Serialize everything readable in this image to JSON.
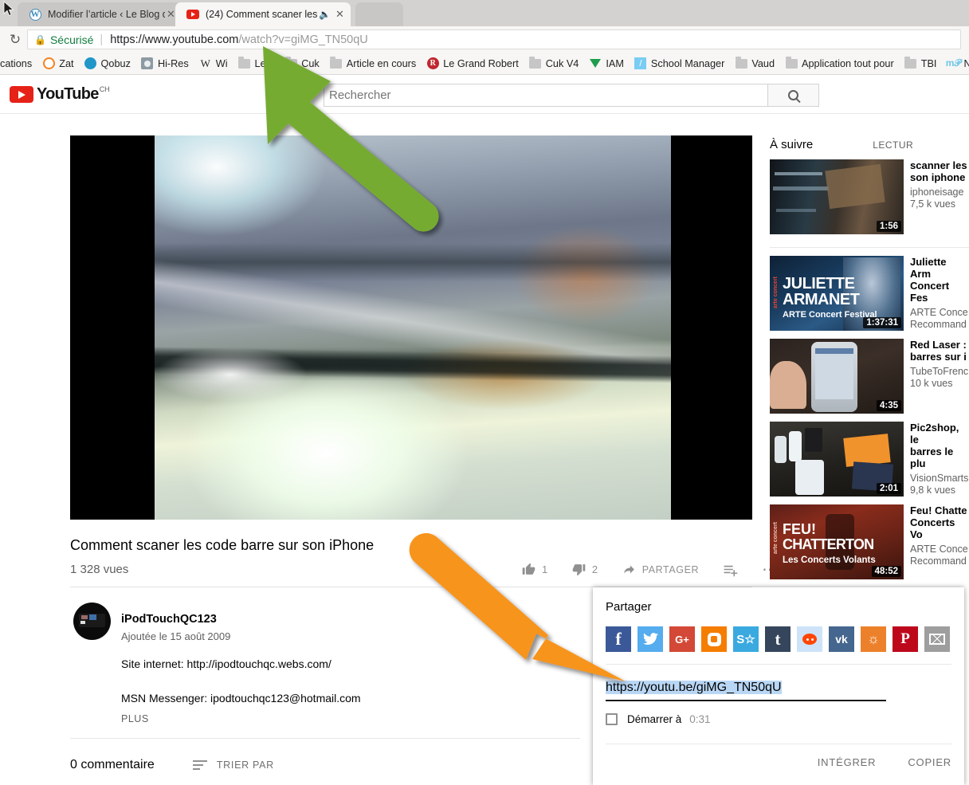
{
  "browser": {
    "tabs": [
      {
        "favicon": "wordpress-icon",
        "title": "Modifier l’article ‹ Le Blog du ",
        "title_fade": "C",
        "active": false,
        "muted": false
      },
      {
        "favicon": "youtube-icon",
        "title": "(24) Comment scaner les ",
        "title_fade": "co",
        "active": true,
        "muted": true
      }
    ],
    "reload_icon": "reload-icon",
    "omnibox": {
      "lock_icon": "lock-icon",
      "secure_label": "Sécurisé",
      "url_prefix": "https://www.youtube.com",
      "url_suffix": "/watch?v=giMG_TN50qU"
    },
    "bookmarks": [
      {
        "label": "cations",
        "icon": "none"
      },
      {
        "label": "Zat",
        "icon": "zat-icon",
        "color": "#F5821F"
      },
      {
        "label": "Qobuz",
        "icon": "qobuz-icon",
        "color": "#2196C9"
      },
      {
        "label": "Hi-Res",
        "icon": "hires-icon",
        "color": "#6E7C86"
      },
      {
        "label": "Wi",
        "icon": "wikipedia-icon",
        "color": "#222222"
      },
      {
        "label": "Le b",
        "icon": "folder-icon"
      },
      {
        "label": "Cuk",
        "icon": "folder-icon"
      },
      {
        "label": "Article en cours",
        "icon": "folder-icon"
      },
      {
        "label": "Le Grand Robert",
        "icon": "robert-icon",
        "color": "#C0272D"
      },
      {
        "label": "Cuk V4",
        "icon": "folder-icon"
      },
      {
        "label": "IAM",
        "icon": "iam-icon",
        "color": "#1F9D4B"
      },
      {
        "label": "School Manager",
        "icon": "school-icon",
        "color": "#79CDF2"
      },
      {
        "label": "Vaud",
        "icon": "folder-icon"
      },
      {
        "label": "Application tout pour",
        "icon": "folder-icon"
      },
      {
        "label": "TBI",
        "icon": "folder-icon"
      },
      {
        "label": "N",
        "icon": "mu-icon",
        "color": "#6FC6E8"
      }
    ]
  },
  "youtube": {
    "logo_word": "YouTube",
    "logo_country": "CH",
    "search": {
      "placeholder": "Rechercher",
      "button_icon": "search-icon"
    },
    "video": {
      "title": "Comment scaner les code barre sur son iPhone",
      "views": "1 328 vues",
      "likes": "1",
      "dislikes": "2",
      "share_label": "PARTAGER",
      "save_icon": "add-to-playlist-icon",
      "more_icon": "more-options-icon"
    },
    "uploader": {
      "name": "iPodTouchQC123",
      "date": "Ajoutée le 15 août 2009",
      "desc_line1": "Site internet: http://ipodtouchqc.webs.com/",
      "desc_line2": "MSN Messenger: ipodtouchqc123@hotmail.com",
      "more_label": "PLUS"
    },
    "comments": {
      "count_label": "0 commentaire",
      "sort_label": "TRIER PAR",
      "sort_icon": "sort-icon"
    },
    "sidebar": {
      "title": "À suivre",
      "autoplay_label": "LECTUR",
      "items": [
        {
          "title": "scanner les\nson iphone",
          "channel": "iphoneisage",
          "views": "7,5 k vues",
          "duration": "1:56",
          "thumb": "dark-shelf"
        },
        {
          "title": "Juliette Arm\nConcert Fes",
          "channel": "ARTE Conce",
          "views": "Recommand",
          "duration": "1:37:31",
          "thumb": "juliette-armanet",
          "thumb_text1": "JULIETTE",
          "thumb_text2": "ARMANET",
          "thumb_text3": "ARTE Concert Festival",
          "thumb_badge": "arte concert"
        },
        {
          "title": "Red Laser :\nbarres sur i",
          "channel": "TubeToFrenc",
          "views": "10 k vues",
          "duration": "4:35",
          "thumb": "iphone-hand"
        },
        {
          "title": "Pic2shop, le\nbarres le plu",
          "channel": "VisionSmarts",
          "views": "9,8 k vues",
          "duration": "2:01",
          "thumb": "desk-products"
        },
        {
          "title": "Feu! Chatte\nConcerts Vo",
          "channel": "ARTE Conce",
          "views": "Recommand",
          "duration": "48:52",
          "thumb": "feu-chatterton",
          "thumb_text1": "FEU!",
          "thumb_text2": "CHATTERTON",
          "thumb_text3": "Les Concerts Volants",
          "thumb_badge": "arte concert"
        }
      ]
    },
    "share_panel": {
      "title": "Partager",
      "social": [
        {
          "name": "facebook",
          "glyph": "f",
          "color": "#3b5998"
        },
        {
          "name": "twitter",
          "glyph": "🐦",
          "color": "#55acee"
        },
        {
          "name": "google-plus",
          "glyph": "G+",
          "color": "#d34836"
        },
        {
          "name": "blogger",
          "glyph": "B",
          "color": "#f57d00"
        },
        {
          "name": "stumbleupon",
          "glyph": "S☆",
          "color": "#3aa9e0"
        },
        {
          "name": "tumblr",
          "glyph": "t",
          "color": "#35465c"
        },
        {
          "name": "reddit",
          "glyph": "●",
          "color": "#cee3f8"
        },
        {
          "name": "vk",
          "glyph": "vk",
          "color": "#45668e"
        },
        {
          "name": "odnoklassniki",
          "glyph": "⚘",
          "color": "#ed812b"
        },
        {
          "name": "pinterest",
          "glyph": "P",
          "color": "#bd081c"
        },
        {
          "name": "email",
          "glyph": "✉",
          "color": "#9e9e9e"
        }
      ],
      "url": "https://youtu.be/giMG_TN50qU",
      "start_at_label": "Démarrer à",
      "start_at_time": "0:31",
      "embed_label": "INTÉGRER",
      "copy_label": "COPIER"
    }
  },
  "annotations": {
    "green_arrow": {
      "color": "#76ab30",
      "points_to": "url-bar"
    },
    "orange_arrow": {
      "color": "#F7941E",
      "points_to": "share-url"
    }
  }
}
